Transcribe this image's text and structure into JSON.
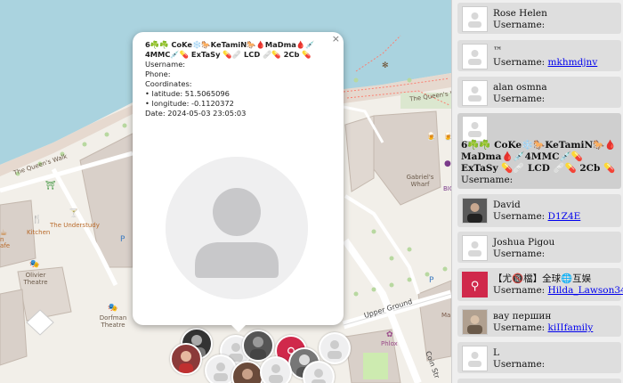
{
  "map": {
    "labels": {
      "queens_walk_1": "The Queen's Walk",
      "queens_walk_2": "The Queen's W",
      "kitchen": "Kitchen",
      "understudy": "The Understudy",
      "olivier": "Olivier Theatre",
      "dorfman": "Dorfman Theatre",
      "gabriels": "Gabriel's Wharf",
      "upper_ground": "Upper Ground",
      "phlox": "Phlox",
      "coin_street": "Coin Str",
      "cafe": "afe",
      "n": "n",
      "bic": "BIC",
      "ma": "Ma"
    }
  },
  "popup": {
    "close": "×",
    "title": "6☘️☘️ CoKe❄️🐎KeTamiN🐎🩸MaDma🩸💉4MMC💉💊 ExTaSy 💊🩹 LCD 🩹💊 2Cb 💊",
    "username_label": "Username:",
    "phone_label": "Phone:",
    "coords_label": "Coordinates:",
    "latitude": "• latitude: 51.5065096",
    "longitude": "• longitude: -0.1120372",
    "date": "Date: 2024-05-03 23:05:03"
  },
  "sidebar": {
    "users": [
      {
        "name": "Rose Helen",
        "username_label": "Username:",
        "username": ""
      },
      {
        "name": "™",
        "username_label": "Username:",
        "username": "mkhmdjnv"
      },
      {
        "name": "alan osmna",
        "username_label": "Username:",
        "username": ""
      },
      {
        "name": "6☘️☘️ CoKe❄️🐎KeTamiN🐎🩸MaDma🩸💉4MMC💉💊 ExTaSy 💊🩹 LCD 🩹💊 2Cb 💊",
        "username_label": "Username:",
        "username": ""
      },
      {
        "name": "David",
        "username_label": "Username:",
        "username": "D1Z4E"
      },
      {
        "name": "Joshua Pigou",
        "username_label": "Username:",
        "username": ""
      },
      {
        "name": "【尤🔞檔】全球🌐互娱",
        "username_label": "Username:",
        "username": "Hilda_Lawson34"
      },
      {
        "name": "вау першин",
        "username_label": "Username:",
        "username": "kiIIfamily"
      },
      {
        "name": "L",
        "username_label": "Username:",
        "username": ""
      }
    ]
  },
  "colors": {
    "water": "#aad3df",
    "selected_card": "#cfcfcf",
    "card": "#dedede",
    "link": "#0000ee",
    "marker_red": "#d0294b"
  },
  "icons": {
    "default_avatar": "person-silhouette-icon",
    "close": "close-icon"
  }
}
